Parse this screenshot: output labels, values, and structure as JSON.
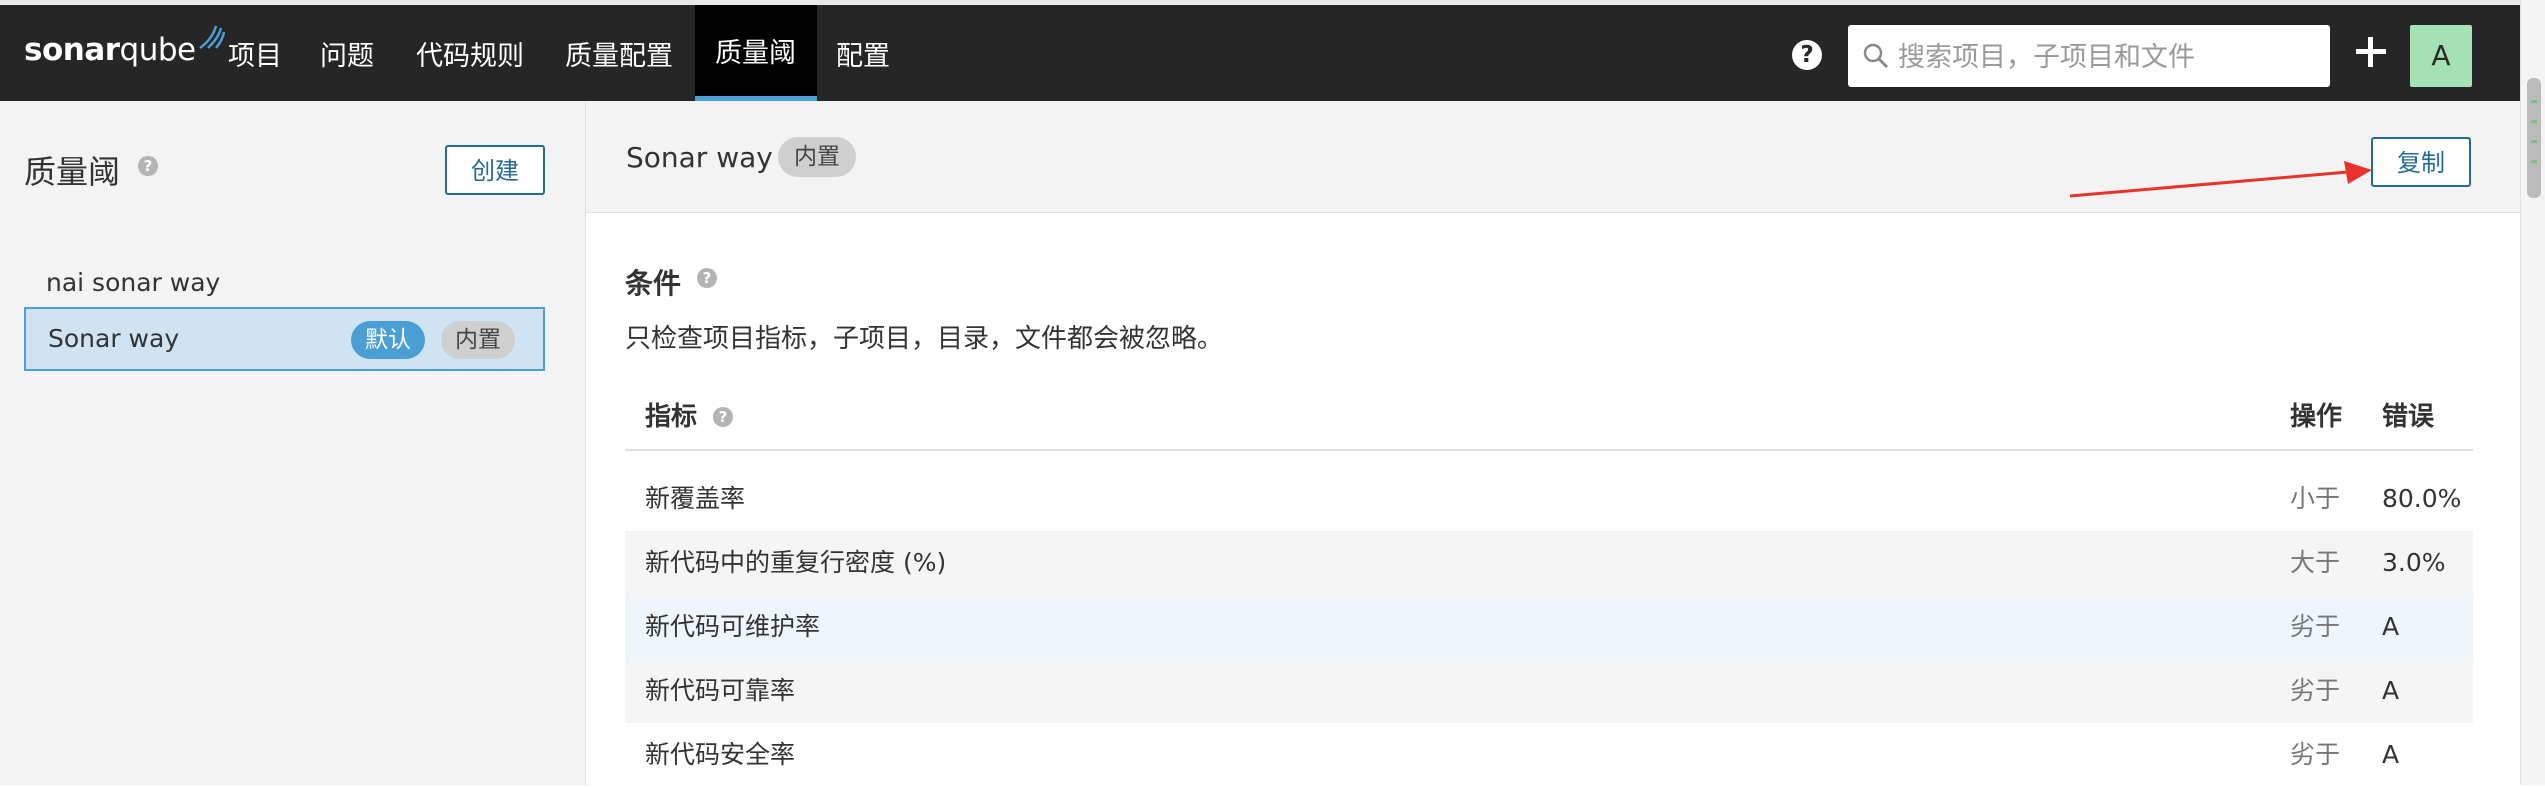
{
  "nav": {
    "logo_bold": "sonar",
    "logo_light": "qube",
    "items": [
      {
        "label": "项目",
        "active": false
      },
      {
        "label": "问题",
        "active": false
      },
      {
        "label": "代码规则",
        "active": false
      },
      {
        "label": "质量配置",
        "active": false
      },
      {
        "label": "质量阈",
        "active": true
      },
      {
        "label": "配置",
        "active": false
      }
    ],
    "search_placeholder": "搜索项目，子项目和文件",
    "avatar_letter": "A",
    "help_icon": "question-circle-icon",
    "plus_icon": "plus-icon"
  },
  "sidebar": {
    "title": "质量阈",
    "create_label": "创建",
    "items": [
      {
        "name": "nai sonar way",
        "selected": false
      },
      {
        "name": "Sonar way",
        "selected": true,
        "badge_default": "默认",
        "badge_builtin": "内置"
      }
    ]
  },
  "main": {
    "gate_name": "Sonar way",
    "builtin_badge": "内置",
    "copy_label": "复制",
    "conditions_title": "条件",
    "conditions_desc": "只检查项目指标，子项目，目录，文件都会被忽略。",
    "headers": {
      "metric": "指标",
      "op": "操作",
      "error": "错误"
    },
    "rows": [
      {
        "metric": "新覆盖率",
        "op": "小于",
        "error": "80.0%"
      },
      {
        "metric": "新代码中的重复行密度 (%)",
        "op": "大于",
        "error": "3.0%"
      },
      {
        "metric": "新代码可维护率",
        "op": "劣于",
        "error": "A"
      },
      {
        "metric": "新代码可靠率",
        "op": "劣于",
        "error": "A"
      },
      {
        "metric": "新代码安全率",
        "op": "劣于",
        "error": "A"
      }
    ]
  },
  "colors": {
    "navbar": "#262626",
    "accent": "#4b9fd5",
    "button_border": "#236a97",
    "annotation_arrow": "#e8322c",
    "row_highlight": "#eef6fc",
    "row_alt": "#f5f5f5"
  }
}
